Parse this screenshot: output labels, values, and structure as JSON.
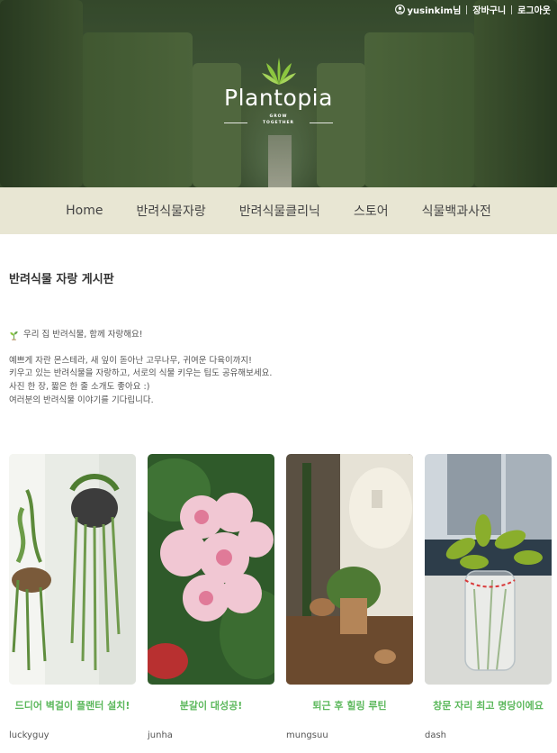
{
  "header": {
    "user_label": "yusinkim님",
    "cart_label": "장바구니",
    "logout_label": "로그아웃",
    "logo_text": "Plantopia",
    "logo_tagline_1": "GROW",
    "logo_tagline_2": "TOGETHER"
  },
  "nav": {
    "items": [
      {
        "label": "Home"
      },
      {
        "label": "반려식물자랑"
      },
      {
        "label": "반려식물클리닉"
      },
      {
        "label": "스토어"
      },
      {
        "label": "식물백과사전"
      }
    ]
  },
  "board": {
    "title": "반려식물 자랑 게시판",
    "headline": "우리 집 반려식물, 함께 자랑해요!",
    "lines": [
      "예쁘게 자란 몬스테라, 새 잎이 돋아난 고무나무, 귀여운 다육이까지!",
      "키우고 있는 반려식물을 자랑하고, 서로의 식물 키우는 팁도 공유해보세요.",
      "사진 한 장, 짧은 한 줄 소개도 좋아요 :)",
      "여러분의 반려식물 이야기를 기다립니다."
    ]
  },
  "posts": [
    {
      "title": "드디어 벽걸이 플랜터 설치!",
      "author": "luckyguy"
    },
    {
      "title": "분갈이 대성공!",
      "author": "junha"
    },
    {
      "title": "퇴근 후 힐링 루틴",
      "author": "mungsuu"
    },
    {
      "title": "창문 자리 최고 명당이에요",
      "author": "dash"
    }
  ],
  "colors": {
    "nav_background": "#e8e6d3",
    "post_title": "#5cb85c",
    "logo_leaf": "#8cc63f"
  }
}
